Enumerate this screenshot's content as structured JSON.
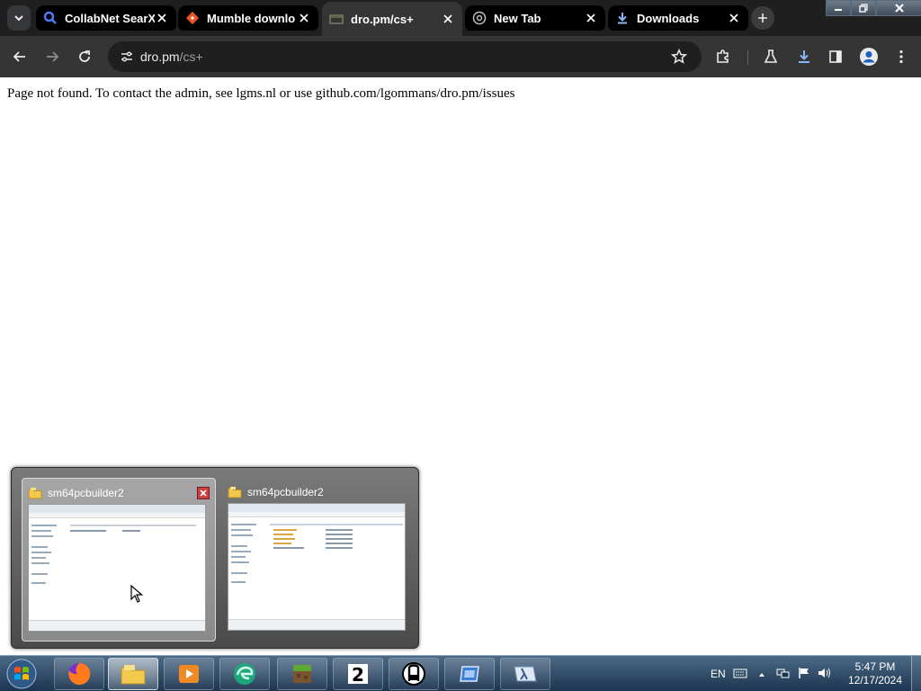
{
  "browser": {
    "tabs": [
      {
        "title": "CollabNet SearX",
        "icon": "search-icon",
        "active": false
      },
      {
        "title": "Mumble downlo",
        "icon": "git-icon",
        "active": false
      },
      {
        "title": "dro.pm/cs+",
        "icon": "page-icon",
        "active": true
      },
      {
        "title": "New Tab",
        "icon": "chrome-icon",
        "active": false
      },
      {
        "title": "Downloads",
        "icon": "download-icon",
        "active": false
      }
    ],
    "address": {
      "host": "dro.pm",
      "path": "/cs+"
    }
  },
  "page": {
    "message": "Page not found. To contact the admin, see lgms.nl or use github.com/lgommans/dro.pm/issues"
  },
  "preview": {
    "windows": [
      {
        "title": "sm64pcbuilder2",
        "icon": "folder-icon"
      },
      {
        "title": "sm64pcbuilder2",
        "icon": "folder-icon"
      }
    ]
  },
  "taskbar": {
    "apps": [
      "start-orb",
      "firefox",
      "explorer",
      "media-player",
      "edge",
      "minecraft",
      "app-2",
      "app-ble",
      "app-blue",
      "app-lambda"
    ],
    "tray": {
      "language": "EN"
    },
    "clock": {
      "time": "5:47 PM",
      "date": "12/17/2024"
    }
  },
  "colors": {
    "chrome_bg": "#1f1f1f",
    "toolbar_bg": "#353535",
    "taskbar_top": "#4c6a86",
    "link_blue": "#8ab4f8"
  }
}
